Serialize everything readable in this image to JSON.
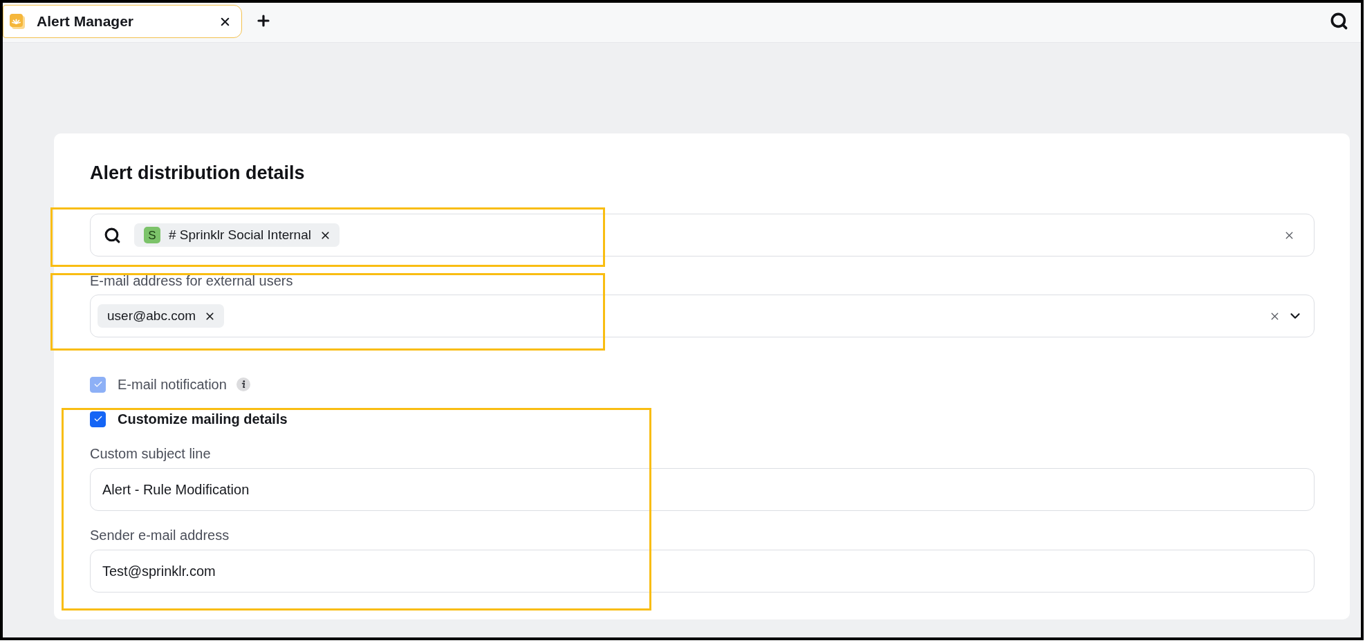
{
  "tabs": [
    {
      "label": "Alert Manager",
      "selected": true
    }
  ],
  "section": {
    "title": "Alert distribution details",
    "form": [
      {
        "kind": "search-tags",
        "tags": [
          {
            "avatar": "S",
            "label": "# Sprinklr Social Internal"
          }
        ]
      },
      {
        "kind": "tag-select",
        "label": "E-mail address for external users",
        "tags": [
          {
            "label": "user@abc.com"
          }
        ]
      },
      {
        "kind": "checkbox",
        "label": "E-mail notification",
        "checked": true,
        "disabled": true,
        "info": true
      },
      {
        "kind": "checkbox",
        "label": "Customize mailing details",
        "checked": true,
        "disabled": false
      },
      {
        "kind": "text",
        "label": "Custom subject line",
        "value": "Alert - Rule Modification"
      },
      {
        "kind": "text",
        "label": "Sender e-mail address",
        "value": "Test@sprinklr.com"
      }
    ]
  }
}
